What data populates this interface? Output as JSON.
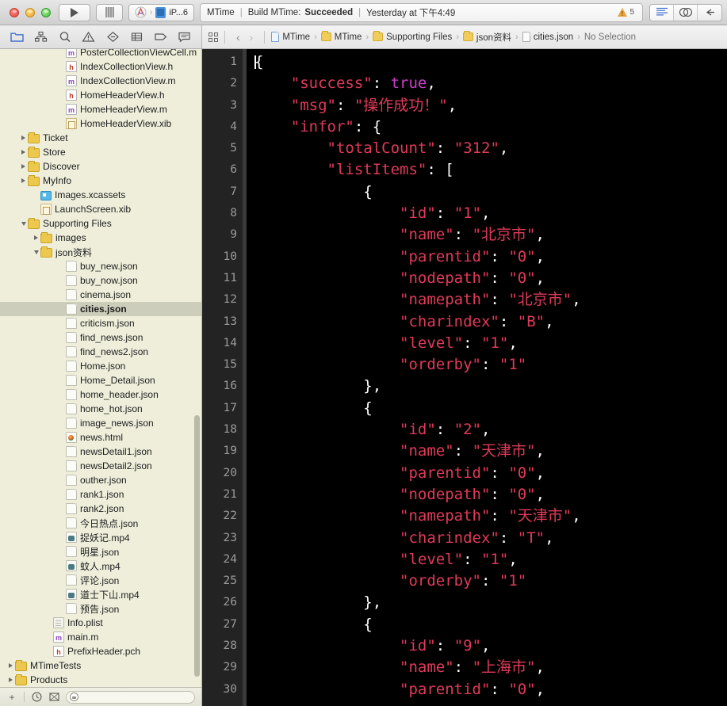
{
  "window": {
    "traffic_lights": [
      "close",
      "minimize",
      "zoom"
    ]
  },
  "toolbar": {
    "run_label": "run",
    "stop_label": "stop",
    "scheme_project": "MTime",
    "scheme_separator": "›",
    "scheme_destination": "iP...6",
    "status": {
      "project": "MTime",
      "sep1": "|",
      "action_prefix": "Build MTime:",
      "action_result": "Succeeded",
      "sep2": "|",
      "time": "Yesterday at 下午4:49"
    },
    "warning_count": "5",
    "right_buttons": [
      "standard-editor",
      "assistant-editor",
      "version-editor"
    ]
  },
  "jumpbar": {
    "back_arrow": "‹",
    "forward_arrow": "›",
    "crumbs": [
      {
        "label": "MTime",
        "icon": "project-icon"
      },
      {
        "label": "MTime",
        "icon": "folder-icon"
      },
      {
        "label": "Supporting Files",
        "icon": "folder-icon"
      },
      {
        "label": "json资料",
        "icon": "folder-icon"
      },
      {
        "label": "cities.json",
        "icon": "json-file-icon"
      },
      {
        "label": "No Selection",
        "icon": "none"
      }
    ],
    "chevron": "›"
  },
  "navigator_toolbar": {
    "items": [
      "project-navigator-icon",
      "symbol-navigator-icon",
      "find-navigator-icon",
      "issue-navigator-icon",
      "test-navigator-icon",
      "debug-navigator-icon",
      "breakpoint-navigator-icon",
      "report-navigator-icon"
    ],
    "selected": "project-navigator-icon"
  },
  "sidebar": {
    "rows": [
      {
        "name": "PosterCollectionViewCell.m",
        "indent": 4,
        "icon": "m",
        "twisty": "none",
        "selected": false,
        "clipped": true
      },
      {
        "name": "IndexCollectionView.h",
        "indent": 4,
        "icon": "h",
        "twisty": "none",
        "selected": false
      },
      {
        "name": "IndexCollectionView.m",
        "indent": 4,
        "icon": "m",
        "twisty": "none",
        "selected": false
      },
      {
        "name": "HomeHeaderView.h",
        "indent": 4,
        "icon": "h",
        "twisty": "none",
        "selected": false
      },
      {
        "name": "HomeHeaderView.m",
        "indent": 4,
        "icon": "m",
        "twisty": "none",
        "selected": false
      },
      {
        "name": "HomeHeaderView.xib",
        "indent": 4,
        "icon": "xib",
        "twisty": "none",
        "selected": false
      },
      {
        "name": "Ticket",
        "indent": 1,
        "icon": "fold",
        "twisty": "right",
        "selected": false
      },
      {
        "name": "Store",
        "indent": 1,
        "icon": "fold",
        "twisty": "right",
        "selected": false
      },
      {
        "name": "Discover",
        "indent": 1,
        "icon": "fold",
        "twisty": "right",
        "selected": false
      },
      {
        "name": "MyInfo",
        "indent": 1,
        "icon": "fold",
        "twisty": "right",
        "selected": false
      },
      {
        "name": "Images.xcassets",
        "indent": 2,
        "icon": "assets",
        "twisty": "none",
        "selected": false
      },
      {
        "name": "LaunchScreen.xib",
        "indent": 2,
        "icon": "xib",
        "twisty": "none",
        "selected": false
      },
      {
        "name": "Supporting Files",
        "indent": 1,
        "icon": "fold",
        "twisty": "down",
        "selected": false
      },
      {
        "name": "images",
        "indent": 2,
        "icon": "fold",
        "twisty": "right",
        "selected": false
      },
      {
        "name": "json资料",
        "indent": 2,
        "icon": "fold",
        "twisty": "down",
        "selected": false
      },
      {
        "name": "buy_new.json",
        "indent": 4,
        "icon": "plain",
        "twisty": "none",
        "selected": false
      },
      {
        "name": "buy_now.json",
        "indent": 4,
        "icon": "plain",
        "twisty": "none",
        "selected": false
      },
      {
        "name": "cinema.json",
        "indent": 4,
        "icon": "plain",
        "twisty": "none",
        "selected": false
      },
      {
        "name": "cities.json",
        "indent": 4,
        "icon": "plain",
        "twisty": "none",
        "selected": true
      },
      {
        "name": "criticism.json",
        "indent": 4,
        "icon": "plain",
        "twisty": "none",
        "selected": false
      },
      {
        "name": "find_news.json",
        "indent": 4,
        "icon": "plain",
        "twisty": "none",
        "selected": false
      },
      {
        "name": "find_news2.json",
        "indent": 4,
        "icon": "plain",
        "twisty": "none",
        "selected": false
      },
      {
        "name": "Home.json",
        "indent": 4,
        "icon": "plain",
        "twisty": "none",
        "selected": false
      },
      {
        "name": "Home_Detail.json",
        "indent": 4,
        "icon": "plain",
        "twisty": "none",
        "selected": false
      },
      {
        "name": "home_header.json",
        "indent": 4,
        "icon": "plain",
        "twisty": "none",
        "selected": false
      },
      {
        "name": "home_hot.json",
        "indent": 4,
        "icon": "plain",
        "twisty": "none",
        "selected": false
      },
      {
        "name": "image_news.json",
        "indent": 4,
        "icon": "plain",
        "twisty": "none",
        "selected": false
      },
      {
        "name": "news.html",
        "indent": 4,
        "icon": "html",
        "twisty": "none",
        "selected": false
      },
      {
        "name": "newsDetail1.json",
        "indent": 4,
        "icon": "plain",
        "twisty": "none",
        "selected": false
      },
      {
        "name": "newsDetail2.json",
        "indent": 4,
        "icon": "plain",
        "twisty": "none",
        "selected": false
      },
      {
        "name": "outher.json",
        "indent": 4,
        "icon": "plain",
        "twisty": "none",
        "selected": false
      },
      {
        "name": "rank1.json",
        "indent": 4,
        "icon": "plain",
        "twisty": "none",
        "selected": false
      },
      {
        "name": "rank2.json",
        "indent": 4,
        "icon": "plain",
        "twisty": "none",
        "selected": false
      },
      {
        "name": "今日热点.json",
        "indent": 4,
        "icon": "plain",
        "twisty": "none",
        "selected": false
      },
      {
        "name": "捉妖记.mp4",
        "indent": 4,
        "icon": "mp4",
        "twisty": "none",
        "selected": false
      },
      {
        "name": "明星.json",
        "indent": 4,
        "icon": "plain",
        "twisty": "none",
        "selected": false
      },
      {
        "name": "蚊人.mp4",
        "indent": 4,
        "icon": "mp4",
        "twisty": "none",
        "selected": false
      },
      {
        "name": "评论.json",
        "indent": 4,
        "icon": "plain",
        "twisty": "none",
        "selected": false
      },
      {
        "name": "道士下山.mp4",
        "indent": 4,
        "icon": "mp4",
        "twisty": "none",
        "selected": false
      },
      {
        "name": "预告.json",
        "indent": 4,
        "icon": "plain",
        "twisty": "none",
        "selected": false
      },
      {
        "name": "Info.plist",
        "indent": 3,
        "icon": "plist",
        "twisty": "none",
        "selected": false
      },
      {
        "name": "main.m",
        "indent": 3,
        "icon": "m",
        "twisty": "none",
        "selected": false
      },
      {
        "name": "PrefixHeader.pch",
        "indent": 3,
        "icon": "h",
        "twisty": "none",
        "selected": false
      },
      {
        "name": "MTimeTests",
        "indent": 0,
        "icon": "fold",
        "twisty": "right",
        "selected": false
      },
      {
        "name": "Products",
        "indent": 0,
        "icon": "fold",
        "twisty": "right",
        "selected": false
      }
    ],
    "bottom_bar": {
      "add_label": "+",
      "recent_icon": "clock-icon",
      "source-control_icon": "modified-files-icon",
      "filter_placeholder": ""
    }
  },
  "editor": {
    "file": "cities.json",
    "first_line_number": 1,
    "lines": [
      {
        "n": "1",
        "tokens": [
          {
            "t": "{",
            "c": "p"
          }
        ]
      },
      {
        "n": "2",
        "tokens": [
          {
            "t": "    ",
            "c": "p"
          },
          {
            "t": "\"success\"",
            "c": "k"
          },
          {
            "t": ": ",
            "c": "p"
          },
          {
            "t": "true",
            "c": "b"
          },
          {
            "t": ",",
            "c": "p"
          }
        ]
      },
      {
        "n": "3",
        "tokens": [
          {
            "t": "    ",
            "c": "p"
          },
          {
            "t": "\"msg\"",
            "c": "k"
          },
          {
            "t": ": ",
            "c": "p"
          },
          {
            "t": "\"操作成功！\"",
            "c": "k"
          },
          {
            "t": ",",
            "c": "p"
          }
        ]
      },
      {
        "n": "4",
        "tokens": [
          {
            "t": "    ",
            "c": "p"
          },
          {
            "t": "\"infor\"",
            "c": "k"
          },
          {
            "t": ": {",
            "c": "p"
          }
        ]
      },
      {
        "n": "5",
        "tokens": [
          {
            "t": "        ",
            "c": "p"
          },
          {
            "t": "\"totalCount\"",
            "c": "k"
          },
          {
            "t": ": ",
            "c": "p"
          },
          {
            "t": "\"312\"",
            "c": "k"
          },
          {
            "t": ",",
            "c": "p"
          }
        ]
      },
      {
        "n": "6",
        "tokens": [
          {
            "t": "        ",
            "c": "p"
          },
          {
            "t": "\"listItems\"",
            "c": "k"
          },
          {
            "t": ": [",
            "c": "p"
          }
        ]
      },
      {
        "n": "7",
        "tokens": [
          {
            "t": "            {",
            "c": "p"
          }
        ]
      },
      {
        "n": "8",
        "tokens": [
          {
            "t": "                ",
            "c": "p"
          },
          {
            "t": "\"id\"",
            "c": "k"
          },
          {
            "t": ": ",
            "c": "p"
          },
          {
            "t": "\"1\"",
            "c": "k"
          },
          {
            "t": ",",
            "c": "p"
          }
        ]
      },
      {
        "n": "9",
        "tokens": [
          {
            "t": "                ",
            "c": "p"
          },
          {
            "t": "\"name\"",
            "c": "k"
          },
          {
            "t": ": ",
            "c": "p"
          },
          {
            "t": "\"北京市\"",
            "c": "k"
          },
          {
            "t": ",",
            "c": "p"
          }
        ]
      },
      {
        "n": "10",
        "tokens": [
          {
            "t": "                ",
            "c": "p"
          },
          {
            "t": "\"parentid\"",
            "c": "k"
          },
          {
            "t": ": ",
            "c": "p"
          },
          {
            "t": "\"0\"",
            "c": "k"
          },
          {
            "t": ",",
            "c": "p"
          }
        ]
      },
      {
        "n": "11",
        "tokens": [
          {
            "t": "                ",
            "c": "p"
          },
          {
            "t": "\"nodepath\"",
            "c": "k"
          },
          {
            "t": ": ",
            "c": "p"
          },
          {
            "t": "\"0\"",
            "c": "k"
          },
          {
            "t": ",",
            "c": "p"
          }
        ]
      },
      {
        "n": "12",
        "tokens": [
          {
            "t": "                ",
            "c": "p"
          },
          {
            "t": "\"namepath\"",
            "c": "k"
          },
          {
            "t": ": ",
            "c": "p"
          },
          {
            "t": "\"北京市\"",
            "c": "k"
          },
          {
            "t": ",",
            "c": "p"
          }
        ]
      },
      {
        "n": "13",
        "tokens": [
          {
            "t": "                ",
            "c": "p"
          },
          {
            "t": "\"charindex\"",
            "c": "k"
          },
          {
            "t": ": ",
            "c": "p"
          },
          {
            "t": "\"B\"",
            "c": "k"
          },
          {
            "t": ",",
            "c": "p"
          }
        ]
      },
      {
        "n": "14",
        "tokens": [
          {
            "t": "                ",
            "c": "p"
          },
          {
            "t": "\"level\"",
            "c": "k"
          },
          {
            "t": ": ",
            "c": "p"
          },
          {
            "t": "\"1\"",
            "c": "k"
          },
          {
            "t": ",",
            "c": "p"
          }
        ]
      },
      {
        "n": "15",
        "tokens": [
          {
            "t": "                ",
            "c": "p"
          },
          {
            "t": "\"orderby\"",
            "c": "k"
          },
          {
            "t": ": ",
            "c": "p"
          },
          {
            "t": "\"1\"",
            "c": "k"
          }
        ]
      },
      {
        "n": "16",
        "tokens": [
          {
            "t": "            },",
            "c": "p"
          }
        ]
      },
      {
        "n": "17",
        "tokens": [
          {
            "t": "            {",
            "c": "p"
          }
        ]
      },
      {
        "n": "18",
        "tokens": [
          {
            "t": "                ",
            "c": "p"
          },
          {
            "t": "\"id\"",
            "c": "k"
          },
          {
            "t": ": ",
            "c": "p"
          },
          {
            "t": "\"2\"",
            "c": "k"
          },
          {
            "t": ",",
            "c": "p"
          }
        ]
      },
      {
        "n": "19",
        "tokens": [
          {
            "t": "                ",
            "c": "p"
          },
          {
            "t": "\"name\"",
            "c": "k"
          },
          {
            "t": ": ",
            "c": "p"
          },
          {
            "t": "\"天津市\"",
            "c": "k"
          },
          {
            "t": ",",
            "c": "p"
          }
        ]
      },
      {
        "n": "20",
        "tokens": [
          {
            "t": "                ",
            "c": "p"
          },
          {
            "t": "\"parentid\"",
            "c": "k"
          },
          {
            "t": ": ",
            "c": "p"
          },
          {
            "t": "\"0\"",
            "c": "k"
          },
          {
            "t": ",",
            "c": "p"
          }
        ]
      },
      {
        "n": "21",
        "tokens": [
          {
            "t": "                ",
            "c": "p"
          },
          {
            "t": "\"nodepath\"",
            "c": "k"
          },
          {
            "t": ": ",
            "c": "p"
          },
          {
            "t": "\"0\"",
            "c": "k"
          },
          {
            "t": ",",
            "c": "p"
          }
        ]
      },
      {
        "n": "22",
        "tokens": [
          {
            "t": "                ",
            "c": "p"
          },
          {
            "t": "\"namepath\"",
            "c": "k"
          },
          {
            "t": ": ",
            "c": "p"
          },
          {
            "t": "\"天津市\"",
            "c": "k"
          },
          {
            "t": ",",
            "c": "p"
          }
        ]
      },
      {
        "n": "23",
        "tokens": [
          {
            "t": "                ",
            "c": "p"
          },
          {
            "t": "\"charindex\"",
            "c": "k"
          },
          {
            "t": ": ",
            "c": "p"
          },
          {
            "t": "\"T\"",
            "c": "k"
          },
          {
            "t": ",",
            "c": "p"
          }
        ]
      },
      {
        "n": "24",
        "tokens": [
          {
            "t": "                ",
            "c": "p"
          },
          {
            "t": "\"level\"",
            "c": "k"
          },
          {
            "t": ": ",
            "c": "p"
          },
          {
            "t": "\"1\"",
            "c": "k"
          },
          {
            "t": ",",
            "c": "p"
          }
        ]
      },
      {
        "n": "25",
        "tokens": [
          {
            "t": "                ",
            "c": "p"
          },
          {
            "t": "\"orderby\"",
            "c": "k"
          },
          {
            "t": ": ",
            "c": "p"
          },
          {
            "t": "\"1\"",
            "c": "k"
          }
        ]
      },
      {
        "n": "26",
        "tokens": [
          {
            "t": "            },",
            "c": "p"
          }
        ]
      },
      {
        "n": "27",
        "tokens": [
          {
            "t": "            {",
            "c": "p"
          }
        ]
      },
      {
        "n": "28",
        "tokens": [
          {
            "t": "                ",
            "c": "p"
          },
          {
            "t": "\"id\"",
            "c": "k"
          },
          {
            "t": ": ",
            "c": "p"
          },
          {
            "t": "\"9\"",
            "c": "k"
          },
          {
            "t": ",",
            "c": "p"
          }
        ]
      },
      {
        "n": "29",
        "tokens": [
          {
            "t": "                ",
            "c": "p"
          },
          {
            "t": "\"name\"",
            "c": "k"
          },
          {
            "t": ": ",
            "c": "p"
          },
          {
            "t": "\"上海市\"",
            "c": "k"
          },
          {
            "t": ",",
            "c": "p"
          }
        ]
      },
      {
        "n": "30",
        "tokens": [
          {
            "t": "                ",
            "c": "p"
          },
          {
            "t": "\"parentid\"",
            "c": "k"
          },
          {
            "t": ": ",
            "c": "p"
          },
          {
            "t": "\"0\"",
            "c": "k"
          },
          {
            "t": ",",
            "c": "p"
          }
        ]
      }
    ]
  },
  "colors": {
    "editor_background": "#000000",
    "gutter_background": "#232323",
    "string_key": "#e03a58",
    "boolean": "#cc3fcc",
    "punctuation": "#ffffff",
    "sidebar_background": "#eeeedb",
    "sidebar_selection": "#cdcdbb"
  }
}
